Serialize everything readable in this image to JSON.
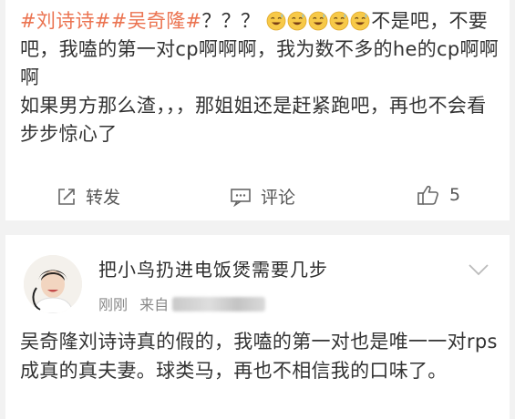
{
  "post": {
    "hashtag_1": "#刘诗诗#",
    "hashtag_2": "#吴奇隆#",
    "marks": "？？？",
    "emoji_icons": [
      "sweat-smile-emoji",
      "sweat-smile-emoji",
      "sweat-smile-emoji",
      "sweat-smile-emoji",
      "sweat-smile-emoji"
    ],
    "text_after_emoji": "不是吧，不要吧，我嗑的第一对cp啊啊啊，我为数不多的he的cp啊啊啊",
    "text_second_paragraph": "如果男方那么渣，，，那姐姐还是赶紧跑吧，再也不会看步步惊心了"
  },
  "actions": {
    "forward_label": "转发",
    "comment_label": "评论",
    "like_count": "5"
  },
  "comment": {
    "username": "把小鸟扔进电饭煲需要几步",
    "time": "刚刚",
    "source_prefix": "来自",
    "body": "吴奇隆刘诗诗真的假的，我嗑的第一对也是唯一一对rps成真的真夫妻。球类马，再也不相信我的口味了。"
  },
  "colors": {
    "hashtag": "#eb7350",
    "text": "#333333",
    "meta": "#888888",
    "background": "#f2f2f2"
  }
}
